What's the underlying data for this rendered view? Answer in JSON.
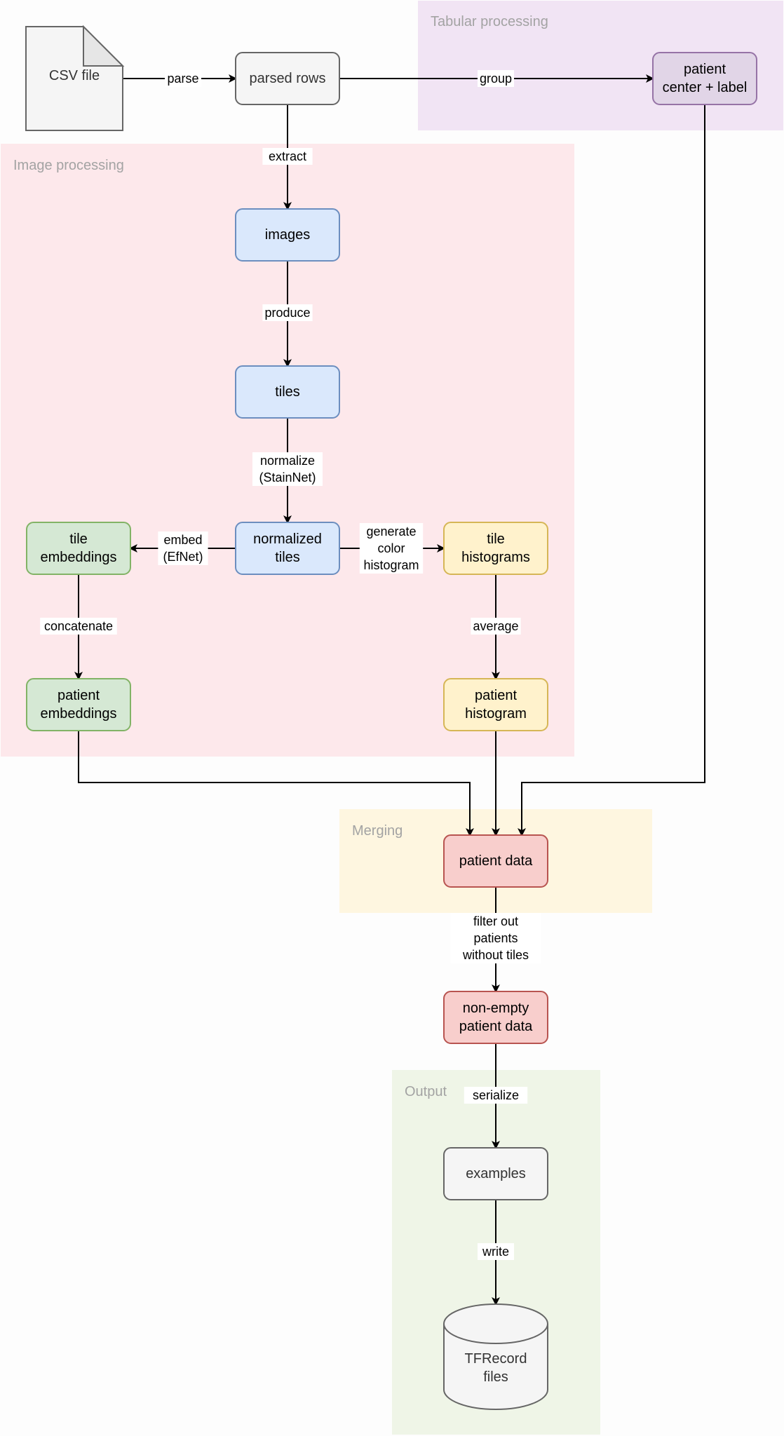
{
  "diagram": {
    "groups": [
      {
        "id": "tabular",
        "label": "Tabular processing",
        "fill": "#f1e4f4"
      },
      {
        "id": "image",
        "label": "Image processing",
        "fill": "#fde8eb"
      },
      {
        "id": "merging",
        "label": "Merging",
        "fill": "#fef6e0"
      },
      {
        "id": "output",
        "label": "Output",
        "fill": "#eff5e7"
      }
    ],
    "nodes": [
      {
        "id": "csv",
        "shape": "document",
        "lines": [
          "CSV file"
        ],
        "fill": "#f5f5f5",
        "stroke": "#666666",
        "text": "#333333"
      },
      {
        "id": "parsed",
        "shape": "rounded",
        "lines": [
          "parsed rows"
        ],
        "fill": "#f5f5f5",
        "stroke": "#666666",
        "text": "#333333"
      },
      {
        "id": "patient_center",
        "shape": "rounded",
        "lines": [
          "patient",
          "center + label"
        ],
        "fill": "#e1d5e7",
        "stroke": "#9673a6",
        "text": "#000000"
      },
      {
        "id": "images",
        "shape": "rounded",
        "lines": [
          "images"
        ],
        "fill": "#dae8fc",
        "stroke": "#6c8ebf",
        "text": "#000000"
      },
      {
        "id": "tiles",
        "shape": "rounded",
        "lines": [
          "tiles"
        ],
        "fill": "#dae8fc",
        "stroke": "#6c8ebf",
        "text": "#000000"
      },
      {
        "id": "norm_tiles",
        "shape": "rounded",
        "lines": [
          "normalized",
          "tiles"
        ],
        "fill": "#dae8fc",
        "stroke": "#6c8ebf",
        "text": "#000000"
      },
      {
        "id": "tile_emb",
        "shape": "rounded",
        "lines": [
          "tile",
          "embeddings"
        ],
        "fill": "#d5e8d4",
        "stroke": "#82b366",
        "text": "#000000"
      },
      {
        "id": "tile_hist",
        "shape": "rounded",
        "lines": [
          "tile",
          "histograms"
        ],
        "fill": "#fff2cc",
        "stroke": "#d6b656",
        "text": "#000000"
      },
      {
        "id": "patient_emb",
        "shape": "rounded",
        "lines": [
          "patient",
          "embeddings"
        ],
        "fill": "#d5e8d4",
        "stroke": "#82b366",
        "text": "#000000"
      },
      {
        "id": "patient_hist",
        "shape": "rounded",
        "lines": [
          "patient",
          "histogram"
        ],
        "fill": "#fff2cc",
        "stroke": "#d6b656",
        "text": "#000000"
      },
      {
        "id": "patient_data",
        "shape": "rounded",
        "lines": [
          "patient data"
        ],
        "fill": "#f8cecc",
        "stroke": "#b85450",
        "text": "#000000"
      },
      {
        "id": "nonempty",
        "shape": "rounded",
        "lines": [
          "non-empty",
          "patient data"
        ],
        "fill": "#f8cecc",
        "stroke": "#b85450",
        "text": "#000000"
      },
      {
        "id": "examples",
        "shape": "rounded",
        "lines": [
          "examples"
        ],
        "fill": "#f5f5f5",
        "stroke": "#666666",
        "text": "#333333"
      },
      {
        "id": "tfrecord",
        "shape": "cylinder",
        "lines": [
          "TFRecord",
          "files"
        ],
        "fill": "#f5f5f5",
        "stroke": "#666666",
        "text": "#333333"
      }
    ],
    "edges": [
      {
        "id": "parse",
        "from": "csv",
        "to": "parsed",
        "label": [
          "parse"
        ]
      },
      {
        "id": "group",
        "from": "parsed",
        "to": "patient_center",
        "label": [
          "group"
        ]
      },
      {
        "id": "extract",
        "from": "parsed",
        "to": "images",
        "label": [
          "extract"
        ]
      },
      {
        "id": "produce",
        "from": "images",
        "to": "tiles",
        "label": [
          "produce"
        ]
      },
      {
        "id": "normalize",
        "from": "tiles",
        "to": "norm_tiles",
        "label": [
          "normalize",
          "(StainNet)"
        ]
      },
      {
        "id": "embed",
        "from": "norm_tiles",
        "to": "tile_emb",
        "label": [
          "embed",
          "(EfNet)"
        ]
      },
      {
        "id": "histogram",
        "from": "norm_tiles",
        "to": "tile_hist",
        "label": [
          "generate",
          "color",
          "histogram"
        ]
      },
      {
        "id": "concatenate",
        "from": "tile_emb",
        "to": "patient_emb",
        "label": [
          "concatenate"
        ]
      },
      {
        "id": "average",
        "from": "tile_hist",
        "to": "patient_hist",
        "label": [
          "average"
        ]
      },
      {
        "id": "merge_emb",
        "from": "patient_emb",
        "to": "patient_data",
        "label": []
      },
      {
        "id": "merge_hist",
        "from": "patient_hist",
        "to": "patient_data",
        "label": []
      },
      {
        "id": "merge_tab",
        "from": "patient_center",
        "to": "patient_data",
        "label": []
      },
      {
        "id": "filter",
        "from": "patient_data",
        "to": "nonempty",
        "label": [
          "filter out",
          "patients",
          "without tiles"
        ]
      },
      {
        "id": "serialize",
        "from": "nonempty",
        "to": "examples",
        "label": [
          "serialize"
        ]
      },
      {
        "id": "write",
        "from": "examples",
        "to": "tfrecord",
        "label": [
          "write"
        ]
      }
    ]
  }
}
